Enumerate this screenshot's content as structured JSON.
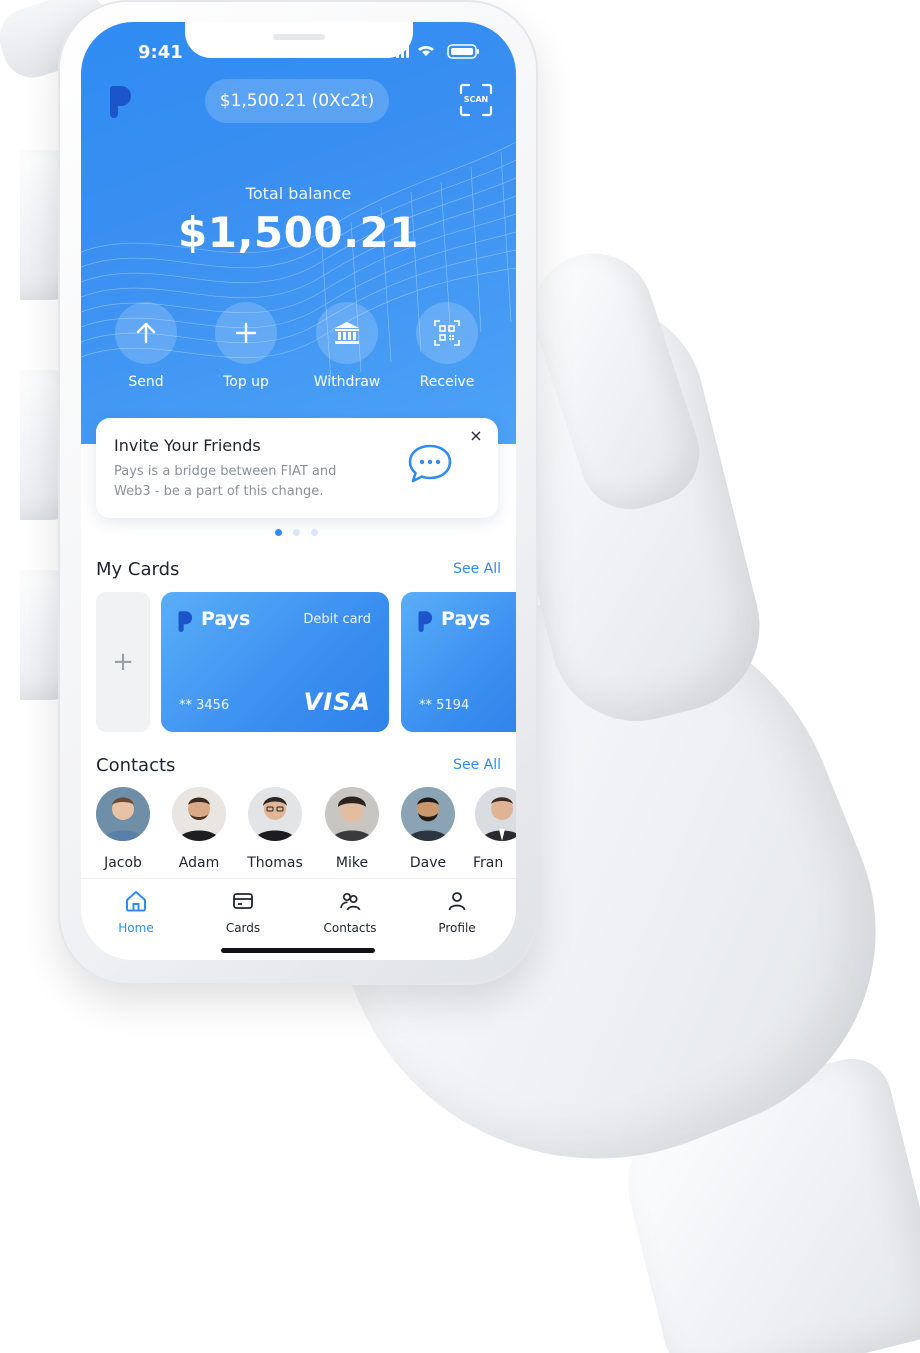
{
  "status_bar": {
    "time": "9:41"
  },
  "header": {
    "balance_pill": "$1,500.21 (0Xc2t)",
    "scan_label": "SCAN"
  },
  "balance": {
    "label": "Total balance",
    "value": "$1,500.21"
  },
  "actions": [
    {
      "label": "Send",
      "icon": "arrow-up-icon"
    },
    {
      "label": "Top up",
      "icon": "plus-icon"
    },
    {
      "label": "Withdraw",
      "icon": "bank-icon"
    },
    {
      "label": "Receive",
      "icon": "qr-code-icon"
    }
  ],
  "invite": {
    "title": "Invite Your Friends",
    "body": "Pays is a bridge between FIAT and Web3 - be a part of this change.",
    "close": "×",
    "icon": "chat-bubble-icon"
  },
  "carousel": {
    "pages": 3,
    "active_index": 0
  },
  "cards_section": {
    "title": "My Cards",
    "see_all": "See All",
    "add_label": "+",
    "cards": [
      {
        "brand": "Pays",
        "type": "Debit card",
        "number": "** 3456",
        "network": "VISA"
      },
      {
        "brand": "Pays",
        "type": "",
        "number": "** 5194",
        "network": ""
      }
    ]
  },
  "contacts_section": {
    "title": "Contacts",
    "see_all": "See All",
    "contacts": [
      {
        "name": "Jacob"
      },
      {
        "name": "Adam"
      },
      {
        "name": "Thomas"
      },
      {
        "name": "Mike"
      },
      {
        "name": "Dave"
      },
      {
        "name": "Fran"
      }
    ]
  },
  "tabbar": {
    "active": "Home",
    "tabs": [
      {
        "label": "Home",
        "icon": "home-icon"
      },
      {
        "label": "Cards",
        "icon": "card-icon"
      },
      {
        "label": "Contacts",
        "icon": "contacts-icon"
      },
      {
        "label": "Profile",
        "icon": "profile-icon"
      }
    ]
  },
  "colors": {
    "accent": "#2f8cf2",
    "hero_gradient_start": "#2f8cf2",
    "hero_gradient_end": "#4da3f6",
    "text_primary": "#1f2430",
    "text_secondary": "#8b909a"
  }
}
